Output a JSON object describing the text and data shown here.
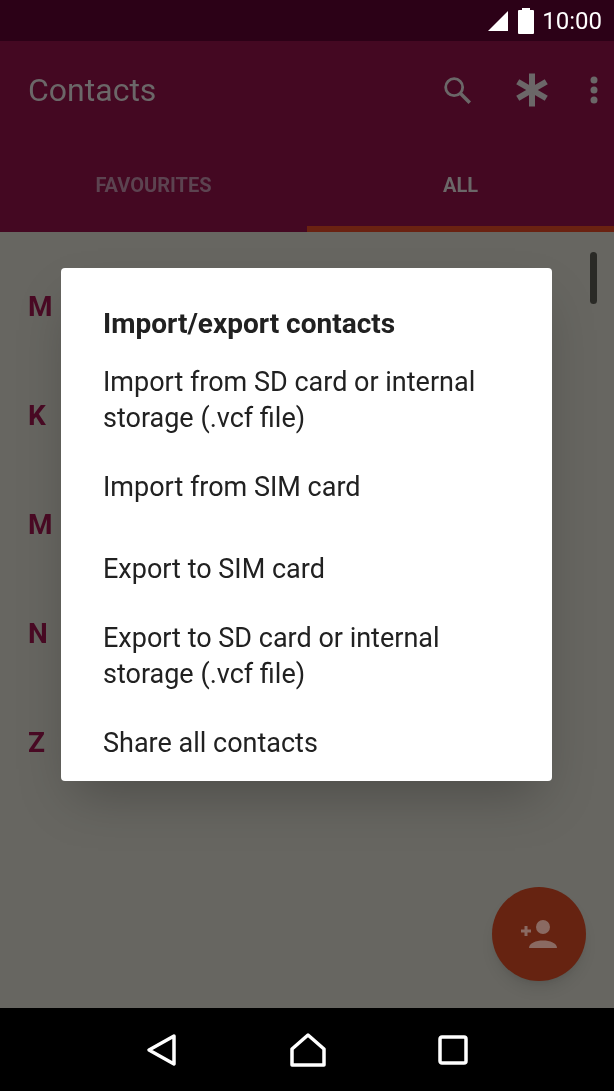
{
  "status_bar": {
    "time": "10:00"
  },
  "app_bar": {
    "title": "Contacts"
  },
  "tabs": [
    {
      "label": "FAVOURITES",
      "selected": false
    },
    {
      "label": "ALL",
      "selected": true
    }
  ],
  "index_letters": [
    "M",
    "K",
    "M",
    "N",
    "Z"
  ],
  "dialog": {
    "title": "Import/export contacts",
    "items": [
      "Import from SD card or internal storage (.vcf file)",
      "Import from SIM card",
      "Export to SIM card",
      "Export to SD card or internal storage (.vcf file)",
      "Share all contacts"
    ]
  }
}
